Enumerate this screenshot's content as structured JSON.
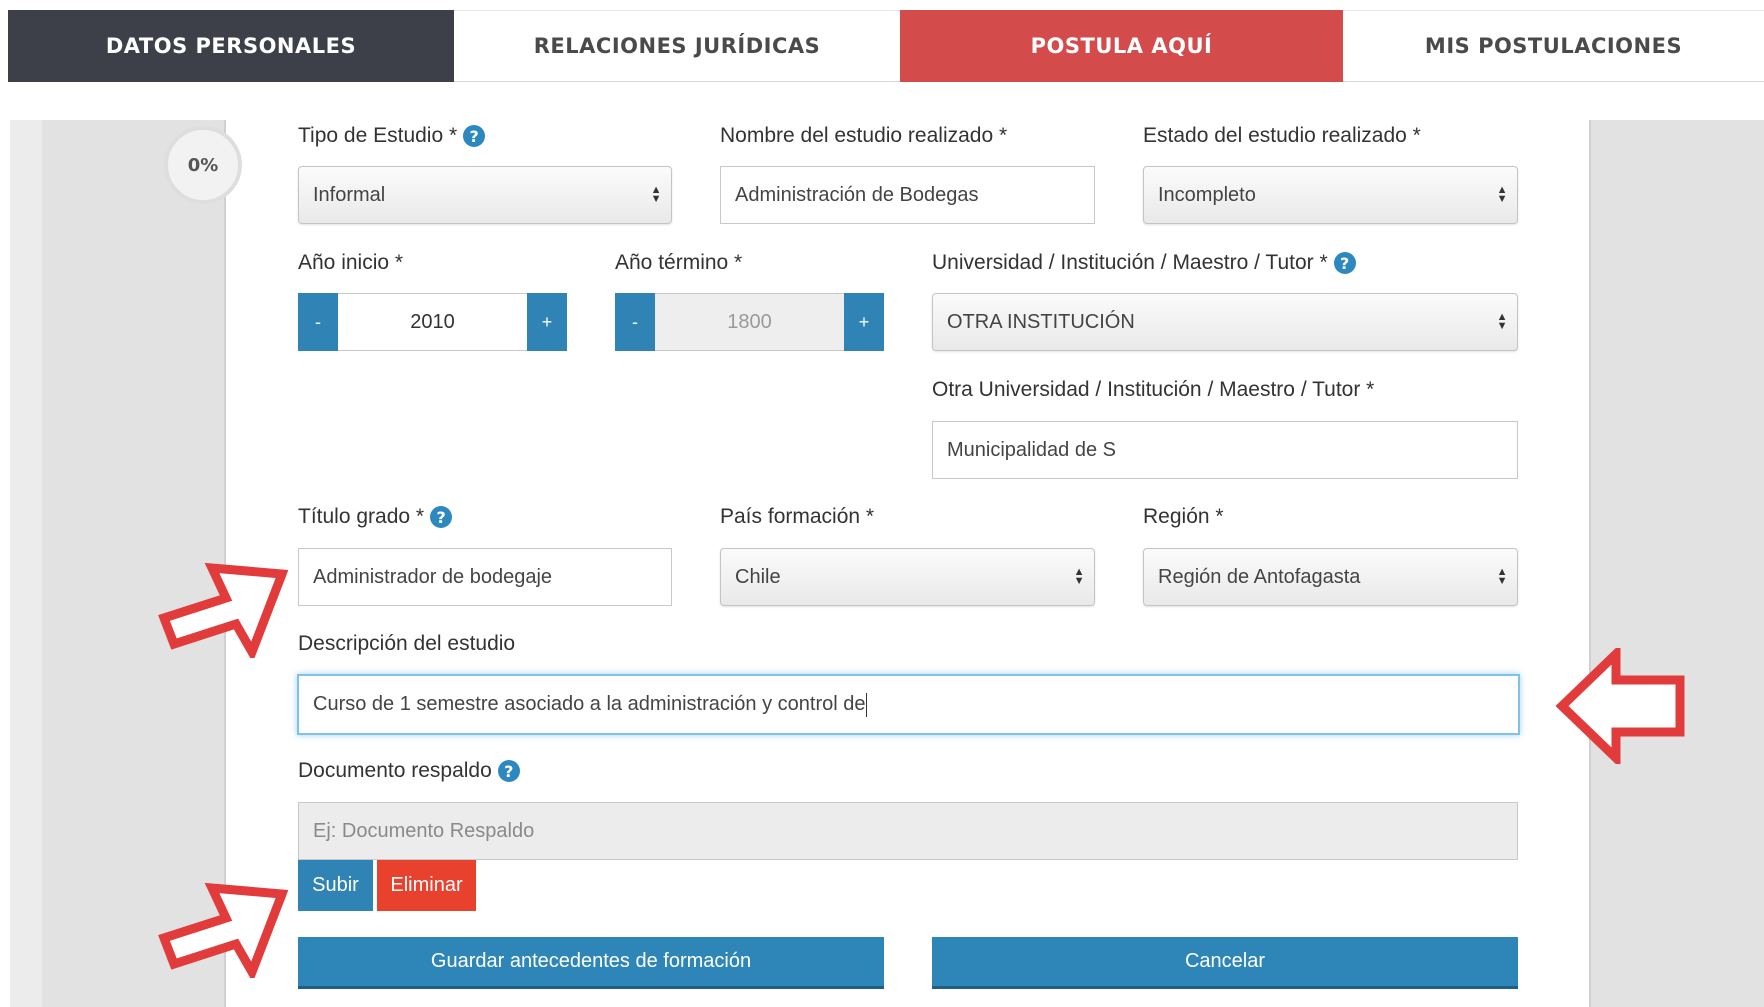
{
  "tabs": [
    {
      "label": "DATOS PERSONALES"
    },
    {
      "label": "RELACIONES JURÍDICAS"
    },
    {
      "label": "POSTULA AQUÍ"
    },
    {
      "label": "MIS POSTULACIONES"
    }
  ],
  "progress": {
    "value": "0%"
  },
  "form": {
    "tipo_estudio": {
      "label": "Tipo de Estudio *",
      "value": "Informal"
    },
    "nombre_estudio": {
      "label": "Nombre del estudio realizado *",
      "value": "Administración de Bodegas"
    },
    "estado_estudio": {
      "label": "Estado del estudio realizado *",
      "value": "Incompleto"
    },
    "anio_inicio": {
      "label": "Año inicio *",
      "value": "2010",
      "minus": "-",
      "plus": "+"
    },
    "anio_termino": {
      "label": "Año término *",
      "value": "1800",
      "minus": "-",
      "plus": "+"
    },
    "universidad": {
      "label": "Universidad / Institución / Maestro / Tutor *",
      "value": "OTRA INSTITUCIÓN"
    },
    "otra_universidad": {
      "label": "Otra Universidad / Institución / Maestro / Tutor *",
      "value": "Municipalidad de S"
    },
    "titulo_grado": {
      "label": "Título grado *",
      "value": "Administrador de bodegaje"
    },
    "pais": {
      "label": "País formación *",
      "value": "Chile"
    },
    "region": {
      "label": "Región *",
      "value": "Región de Antofagasta"
    },
    "descripcion": {
      "label": "Descripción del estudio",
      "value": "Curso de 1 semestre asociado a la administración y control de"
    },
    "documento": {
      "label": "Documento respaldo",
      "placeholder": "Ej: Documento Respaldo"
    }
  },
  "buttons": {
    "subir": "Subir",
    "eliminar": "Eliminar",
    "guardar": "Guardar antecedentes de formación",
    "cancelar": "Cancelar"
  },
  "help_icon": "?",
  "colors": {
    "tab_active_dark": "#3e4049",
    "tab_highlight": "#d34b4b",
    "primary_blue": "#2f84b5",
    "danger_red": "#e8412e",
    "annotation_arrow": "#e23b3b"
  }
}
